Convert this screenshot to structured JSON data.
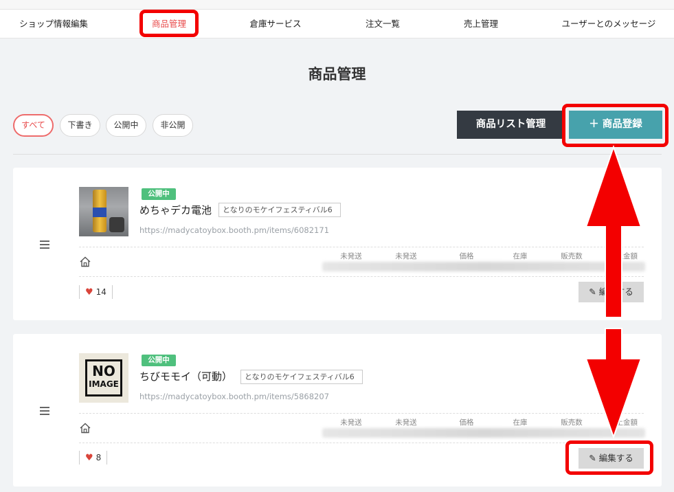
{
  "nav": {
    "items": [
      {
        "label": "ショップ情報編集"
      },
      {
        "label": "商品管理"
      },
      {
        "label": "倉庫サービス"
      },
      {
        "label": "注文一覧"
      },
      {
        "label": "売上管理"
      },
      {
        "label": "ユーザーとのメッセージ"
      }
    ],
    "active_index": 1
  },
  "page_title": "商品管理",
  "filters": [
    {
      "label": "すべて",
      "active": true
    },
    {
      "label": "下書き",
      "active": false
    },
    {
      "label": "公開中",
      "active": false
    },
    {
      "label": "非公開",
      "active": false
    }
  ],
  "actions": {
    "list_manage_label": "商品リスト管理",
    "register_label": "＋ 商品登録"
  },
  "stat_headers": [
    "未発送",
    "未発送",
    "価格",
    "在庫",
    "販売数",
    "売上金額"
  ],
  "products": [
    {
      "status": "公開中",
      "name": "めちゃデカ電池",
      "shop": "となりのモケイフェスティバル6",
      "url": "https://madycatoybox.booth.pm/items/6082171",
      "likes": "14",
      "edit_label": "編集する",
      "thumbnail": "photo"
    },
    {
      "status": "公開中",
      "name": "ちびモモイ（可動）",
      "shop": "となりのモケイフェスティバル6",
      "url": "https://madycatoybox.booth.pm/items/5868207",
      "likes": "8",
      "edit_label": "編集する",
      "thumbnail": "no-image",
      "no_image_text": [
        "NO",
        "IMAGE"
      ]
    }
  ],
  "colors": {
    "accent_red": "#e84a4a",
    "teal": "#47a2ac",
    "dark": "#343a42",
    "status_green": "#4fc07d",
    "highlight": "#f30000"
  }
}
